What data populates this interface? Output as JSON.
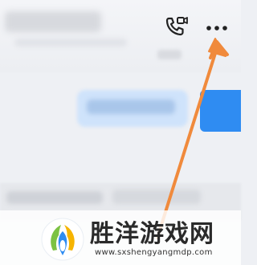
{
  "header": {
    "icons": {
      "call": "video-call-icon",
      "more": "more-options-icon"
    }
  },
  "colors": {
    "accent_blue": "#2f8cf2",
    "arrow": "#f08a3c",
    "background": "#eef0f4"
  },
  "watermark": {
    "title": "胜洋游戏网",
    "url": "www.sxshengyangmdp.com"
  }
}
